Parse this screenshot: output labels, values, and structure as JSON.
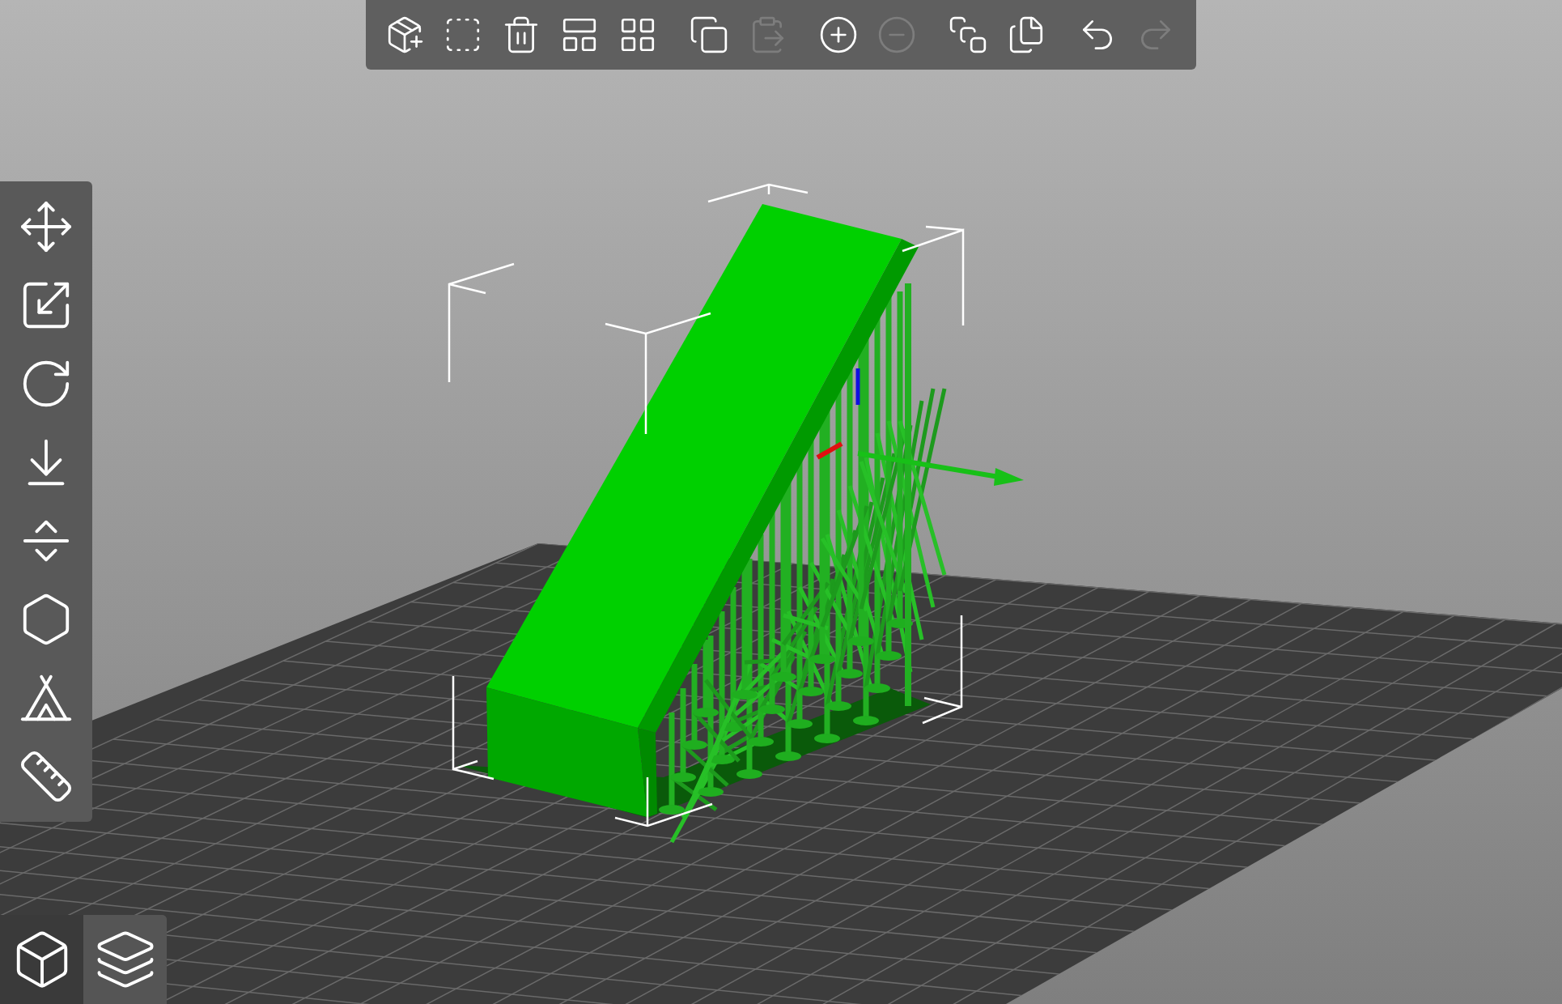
{
  "top_toolbar": [
    {
      "tools": [
        {
          "kind": "add",
          "disabled": false
        },
        {
          "kind": "delete",
          "disabled": false
        },
        {
          "kind": "delete_all",
          "disabled": false
        },
        {
          "kind": "arrange",
          "disabled": false
        },
        {
          "kind": "arrange_selection",
          "disabled": false
        }
      ]
    },
    {
      "tools": [
        {
          "kind": "copy",
          "disabled": false
        },
        {
          "kind": "paste",
          "disabled": true
        }
      ]
    },
    {
      "tools": [
        {
          "kind": "add_instance",
          "disabled": false
        },
        {
          "kind": "remove_instance",
          "disabled": true
        }
      ]
    },
    {
      "tools": [
        {
          "kind": "split_objects",
          "disabled": false
        },
        {
          "kind": "split_parts",
          "disabled": false
        }
      ]
    },
    {
      "tools": [
        {
          "kind": "undo",
          "disabled": false
        },
        {
          "kind": "redo",
          "disabled": true
        }
      ]
    }
  ],
  "gizmos": [
    {
      "kind": "move"
    },
    {
      "kind": "scale"
    },
    {
      "kind": "rotate"
    },
    {
      "kind": "place_on_face"
    },
    {
      "kind": "cut"
    },
    {
      "kind": "hollow"
    },
    {
      "kind": "supports"
    },
    {
      "kind": "measure"
    }
  ],
  "view_toggle": [
    {
      "kind": "perspective",
      "selected": true
    },
    {
      "kind": "preview",
      "selected": false
    }
  ]
}
